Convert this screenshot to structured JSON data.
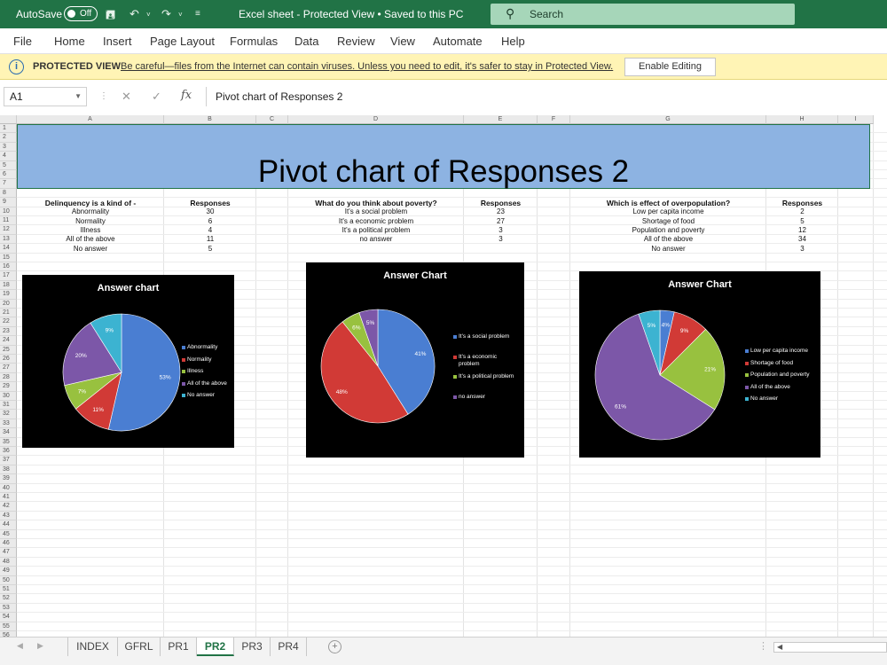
{
  "titlebar": {
    "autosave_label": "AutoSave",
    "autosave_state": "Off",
    "document_title": "Excel sheet  -  Protected View • Saved to this PC",
    "search_placeholder": "Search"
  },
  "menu": [
    "File",
    "Home",
    "Insert",
    "Page Layout",
    "Formulas",
    "Data",
    "Review",
    "View",
    "Automate",
    "Help"
  ],
  "protected_view": {
    "label": "PROTECTED VIEW",
    "message": "Be careful—files from the Internet can contain viruses. Unless you need to edit, it's safer to stay in Protected View.",
    "button": "Enable Editing"
  },
  "formula_bar": {
    "name_box": "A1",
    "fx": "fx",
    "formula": "Pivot chart of Responses 2"
  },
  "columns": [
    "A",
    "B",
    "C",
    "D",
    "E",
    "F",
    "G",
    "H",
    "I"
  ],
  "rows": [
    "1",
    "2",
    "3",
    "4",
    "5",
    "6",
    "7",
    "8",
    "9",
    "10",
    "11",
    "12",
    "13",
    "14",
    "15",
    "16",
    "17",
    "18",
    "19",
    "20",
    "21",
    "22",
    "23",
    "24",
    "25",
    "26",
    "27",
    "28",
    "29",
    "30",
    "31",
    "32",
    "33",
    "34",
    "35",
    "36",
    "37",
    "38",
    "39",
    "40",
    "41",
    "42",
    "43",
    "44",
    "45",
    "46",
    "47",
    "48",
    "49",
    "50",
    "51",
    "52",
    "53",
    "54",
    "55",
    "56"
  ],
  "banner_title": "Pivot chart of Responses 2",
  "table1": {
    "header": "Delinquency is a kind of -",
    "col2": "Responses",
    "rows": [
      {
        "label": "Abnormality",
        "value": "30"
      },
      {
        "label": "Normality",
        "value": "6"
      },
      {
        "label": "Illness",
        "value": "4"
      },
      {
        "label": "All of the above",
        "value": "11"
      },
      {
        "label": "No answer",
        "value": "5"
      }
    ]
  },
  "table2": {
    "header": "What do you think about poverty?",
    "col2": "Responses",
    "rows": [
      {
        "label": "It's a social problem",
        "value": "23"
      },
      {
        "label": "It's a economic problem",
        "value": "27"
      },
      {
        "label": "It's a political problem",
        "value": "3"
      },
      {
        "label": "no answer",
        "value": "3"
      }
    ]
  },
  "table3": {
    "header": "Which is effect of overpopulation?",
    "col2": "Responses",
    "rows": [
      {
        "label": "Low per capita income",
        "value": "2"
      },
      {
        "label": "Shortage of food",
        "value": "5"
      },
      {
        "label": "Population and poverty",
        "value": "12"
      },
      {
        "label": "All of the above",
        "value": "34"
      },
      {
        "label": "No answer",
        "value": "3"
      }
    ]
  },
  "chart_data": [
    {
      "type": "pie",
      "title": "Answer chart",
      "categories": [
        "Abnormality",
        "Normality",
        "Illness",
        "All of the above",
        "No answer"
      ],
      "values": [
        30,
        6,
        4,
        11,
        5
      ],
      "labels": [
        "53%",
        "11%",
        "7%",
        "20%",
        "9%"
      ],
      "colors": [
        "#4a7ed2",
        "#d13a36",
        "#98c13f",
        "#7c57a8",
        "#3cb3d1"
      ],
      "legend_position": "right"
    },
    {
      "type": "pie",
      "title": "Answer Chart",
      "categories": [
        "It's a social problem",
        "It's a economic problem",
        "It's a political problem",
        "no answer"
      ],
      "values": [
        23,
        27,
        3,
        3
      ],
      "labels": [
        "41%",
        "48%",
        "6%",
        "5%"
      ],
      "colors": [
        "#4a7ed2",
        "#d13a36",
        "#98c13f",
        "#7c57a8"
      ],
      "legend_position": "right"
    },
    {
      "type": "pie",
      "title": "Answer Chart",
      "categories": [
        "Low per capita income",
        "Shortage of food",
        "Population and poverty",
        "All of the above",
        "No answer"
      ],
      "values": [
        2,
        5,
        12,
        34,
        3
      ],
      "labels": [
        "4%",
        "9%",
        "21%",
        "61%",
        "5%"
      ],
      "colors": [
        "#4a7ed2",
        "#d13a36",
        "#98c13f",
        "#7c57a8",
        "#3cb3d1"
      ],
      "legend_position": "right"
    }
  ],
  "sheet_tabs": [
    "INDEX",
    "GFRL",
    "PR1",
    "PR2",
    "PR3",
    "PR4"
  ],
  "active_tab": "PR2",
  "add_sheet": "+"
}
